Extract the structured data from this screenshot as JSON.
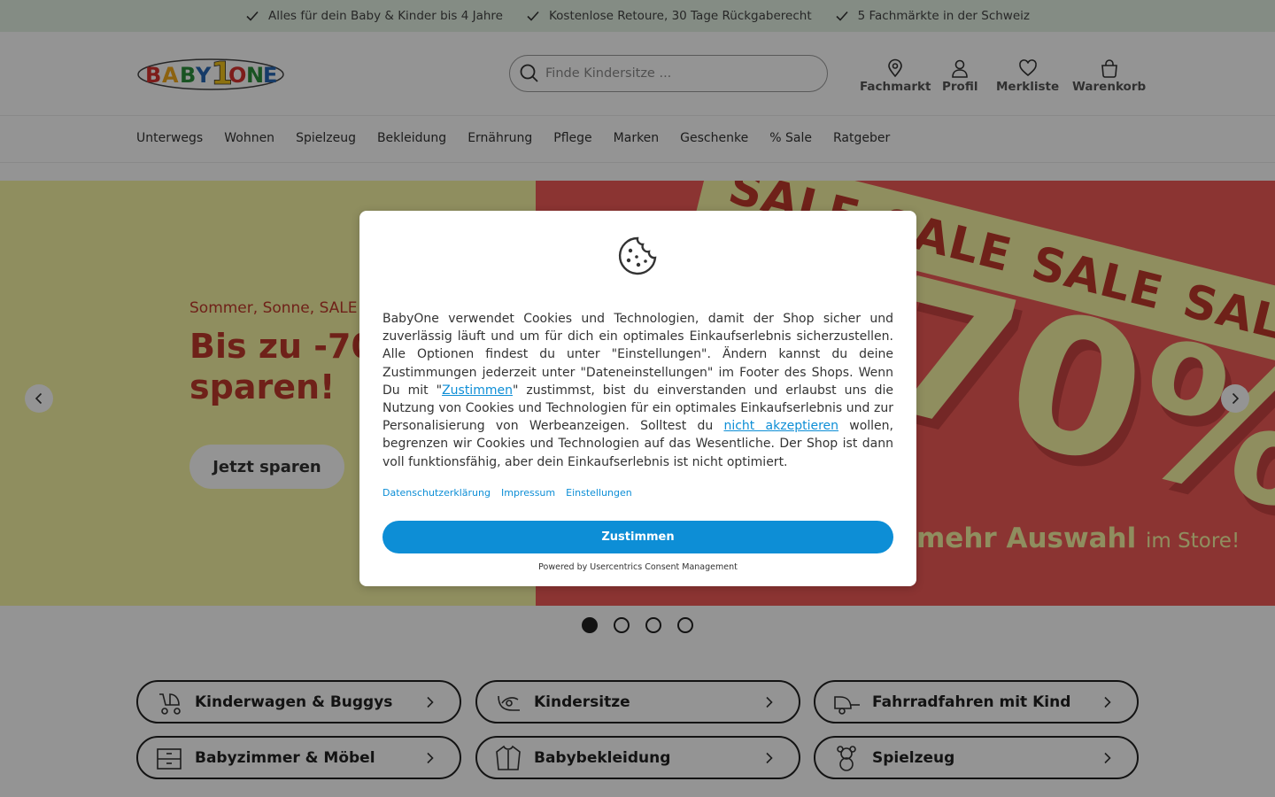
{
  "usp": {
    "items": [
      "Alles für dein Baby & Kinder bis 4 Jahre",
      "Kostenlose Retoure, 30 Tage Rückgaberecht",
      "5 Fachmärkte in der Schweiz"
    ]
  },
  "header": {
    "logo_text": "BABY1ONE",
    "search_placeholder": "Finde Kindersitze ...",
    "icons": {
      "store": "Fachmarkt",
      "profile": "Profil",
      "wishlist": "Merkliste",
      "cart": "Warenkorb"
    }
  },
  "nav": {
    "items": [
      "Unterwegs",
      "Wohnen",
      "Spielzeug",
      "Bekleidung",
      "Ernährung",
      "Pflege",
      "Marken",
      "Geschenke",
      "% Sale",
      "Ratgeber"
    ]
  },
  "hero": {
    "kicker": "Sommer, Sonne, SALE!",
    "title": "Bis zu -70%\nsparen!",
    "button": "Jetzt sparen",
    "sale_words": [
      "SALE",
      "SALE",
      "SALE",
      "SALE"
    ],
    "percent": "70%",
    "more_bold": "mehr Auswahl",
    "more_rest": "im Store!",
    "slides_total": 4,
    "active_slide": 1
  },
  "categories": [
    {
      "label": "Kinderwagen & Buggys",
      "icon": "stroller-icon"
    },
    {
      "label": "Kindersitze",
      "icon": "car-seat-icon"
    },
    {
      "label": "Fahrradfahren mit Kind",
      "icon": "bike-trailer-icon"
    },
    {
      "label": "Babyzimmer & Möbel",
      "icon": "dresser-icon"
    },
    {
      "label": "Babybekleidung",
      "icon": "jacket-icon"
    },
    {
      "label": "Spielzeug",
      "icon": "teddy-icon"
    }
  ],
  "cookie": {
    "text_1": "BabyOne verwendet Cookies und Technologien, damit der Shop sicher und zuverlässig läuft und um für dich ein optimales Einkaufserlebnis sicherzustellen. Alle Optionen findest du unter \"Einstellungen\". Ändern kannst du deine Zustimmungen jederzeit unter \"Dateneinstellungen\" im Footer des Shops. Wenn Du mit \"",
    "link_accept": "Zustimmen",
    "text_2": "\" zustimmst, bist du einverstanden und erlaubst uns die Nutzung von Cookies und Technologien für ein optimales Einkaufserlebnis und zur Personalisierung von Werbeanzeigen. Solltest du ",
    "link_decline": "nicht akzeptieren",
    "text_3": " wollen, begrenzen wir Cookies und Technologien auf das Wesentliche. Der Shop ist dann voll funktionsfähig, aber dein Einkaufserlebnis ist nicht optimiert.",
    "links": [
      "Datenschutzerklärung",
      "Impressum",
      "Einstellungen"
    ],
    "accept_button": "Zustimmen",
    "powered_by": "Powered by Usercentrics Consent Management"
  },
  "colors": {
    "accent": "#0d8ed6",
    "hero_yellow": "#f6f5a4",
    "hero_red": "#f05a57",
    "usp_green": "#e4f1e4"
  }
}
